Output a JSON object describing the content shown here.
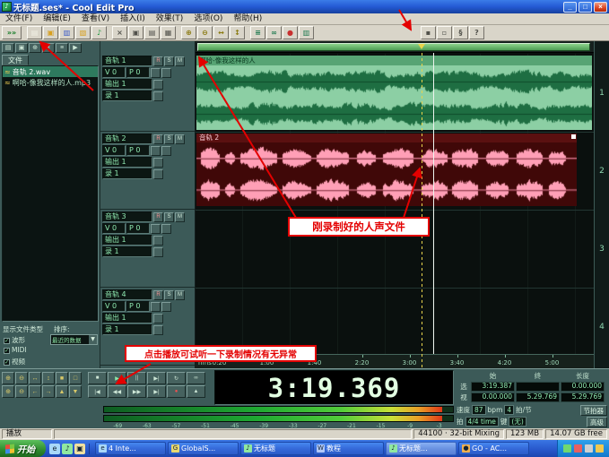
{
  "titlebar": {
    "title": "无标题.ses* - Cool Edit Pro",
    "min": "_",
    "max": "□",
    "close": "×"
  },
  "menu": {
    "items": [
      "文件(F)",
      "编辑(E)",
      "查看(V)",
      "插入(I)",
      "效果(T)",
      "选项(O)",
      "帮助(H)"
    ]
  },
  "toolbar": {
    "buttons": [
      {
        "name": "toggle-view",
        "g": "»»",
        "c": "#0f7a22"
      },
      {
        "name": "new-session",
        "g": "▤",
        "c": "#f0efe4"
      },
      {
        "name": "open-file",
        "g": "▣",
        "c": "#d8a020"
      },
      {
        "name": "save-session",
        "g": "▥",
        "c": "#3a5ac8"
      },
      {
        "name": "import-file",
        "g": "▧",
        "c": "#d8a020"
      },
      {
        "name": "mixdown",
        "g": "♪",
        "c": "#1f9a40"
      },
      {
        "name": "cut",
        "g": "×",
        "c": "#50504a"
      },
      {
        "name": "copy",
        "g": "▣",
        "c": "#50504a"
      },
      {
        "name": "paste",
        "g": "▤",
        "c": "#50504a"
      },
      {
        "name": "mix-paste",
        "g": "▦",
        "c": "#50504a"
      },
      {
        "name": "zoom-in",
        "g": "⊕",
        "c": "#8a7a10"
      },
      {
        "name": "zoom-out",
        "g": "⊖",
        "c": "#8a7a10"
      },
      {
        "name": "zoom-selection",
        "g": "↔",
        "c": "#8a7a10"
      },
      {
        "name": "zoom-full",
        "g": "↕",
        "c": "#8a7a10"
      },
      {
        "name": "track-eq",
        "g": "≡",
        "c": "#1f7a50"
      },
      {
        "name": "loop-mode",
        "g": "∞",
        "c": "#1f7a50"
      },
      {
        "name": "punch-in",
        "g": "●",
        "c": "#c83030"
      },
      {
        "name": "mixer",
        "g": "▥",
        "c": "#1f7a50"
      },
      {
        "name": "group-clips",
        "g": "▪",
        "c": "#50504a"
      },
      {
        "name": "snapping",
        "g": "▫",
        "c": "#50504a"
      },
      {
        "name": "session-properties",
        "g": "§",
        "c": "#50504a"
      },
      {
        "name": "help",
        "g": "?",
        "c": "#50504a"
      }
    ]
  },
  "file_panel": {
    "top_buttons": [
      {
        "name": "organizer-new",
        "g": "▤"
      },
      {
        "name": "organizer-open",
        "g": "▣"
      },
      {
        "name": "organizer-insert",
        "g": "⊕"
      },
      {
        "name": "organizer-close",
        "g": "×"
      },
      {
        "name": "organizer-options",
        "g": "≡"
      },
      {
        "name": "organizer-play",
        "g": "▶"
      }
    ],
    "tab": "文件",
    "files": [
      {
        "icon": "≈",
        "name": "音轨 2.wav"
      },
      {
        "icon": "≈",
        "name": "啊哈-像我这样的人.mp3"
      }
    ],
    "filter_title": "显示文件类型",
    "sort_label": "排序:",
    "check": "✓",
    "types": [
      "波形",
      "MIDI",
      "视频"
    ],
    "sort_value": "最近的数据"
  },
  "tracks": [
    {
      "num": "1",
      "name": "音轨 1",
      "r": "R",
      "s": "S",
      "m": "M",
      "vol": "V 0",
      "pan": "P 0",
      "out": "输出 1",
      "rec": "录 1"
    },
    {
      "num": "2",
      "name": "音轨 2",
      "r": "R",
      "s": "S",
      "m": "M",
      "vol": "V 0",
      "pan": "P 0",
      "out": "输出 1",
      "rec": "录 1"
    },
    {
      "num": "3",
      "name": "音轨 3",
      "r": "R",
      "s": "S",
      "m": "M",
      "vol": "V 0",
      "pan": "P 0",
      "out": "输出 1",
      "rec": "录 1"
    },
    {
      "num": "4",
      "name": "音轨 4",
      "r": "R",
      "s": "S",
      "m": "M",
      "vol": "V 0",
      "pan": "P 0",
      "out": "输出 1",
      "rec": "录 1"
    }
  ],
  "clips": {
    "clip1_title": "啊哈-像我这样的人",
    "clip2_title": "音轨 2"
  },
  "ruler": {
    "unit": "hms",
    "ticks": [
      "0:20",
      "1:00",
      "1:40",
      "2:20",
      "3:00",
      "3:40",
      "4:20",
      "5:00"
    ]
  },
  "zoom": {
    "buttons": [
      {
        "name": "zoom-in",
        "g": "⊕"
      },
      {
        "name": "zoom-out",
        "g": "⊖"
      },
      {
        "name": "zoom-h",
        "g": "↔"
      },
      {
        "name": "zoom-v",
        "g": "↕"
      },
      {
        "name": "zoom-selection",
        "g": "■"
      },
      {
        "name": "zoom-all",
        "g": "□"
      },
      {
        "name": "zoom-in-vert",
        "g": "⊕"
      },
      {
        "name": "zoom-out-vert",
        "g": "⊖"
      },
      {
        "name": "zoom-left",
        "g": "←"
      },
      {
        "name": "zoom-right",
        "g": "→"
      },
      {
        "name": "zoom-up",
        "g": "▲"
      },
      {
        "name": "zoom-down",
        "g": "▼"
      }
    ]
  },
  "transport": {
    "buttons": [
      {
        "name": "stop",
        "g": "■",
        "c": "#cfe8d8"
      },
      {
        "name": "play",
        "g": "▶",
        "c": "#8fe8a8"
      },
      {
        "name": "pause",
        "g": "||",
        "c": "#cfe8d8"
      },
      {
        "name": "play-to-end",
        "g": "▶|",
        "c": "#cfe8d8"
      },
      {
        "name": "play-looped",
        "g": "↻",
        "c": "#cfe8d8"
      },
      {
        "name": "loop",
        "g": "∞",
        "c": "#cfe8d8"
      },
      {
        "name": "go-to-start",
        "g": "|◀",
        "c": "#cfe8d8"
      },
      {
        "name": "rewind",
        "g": "◀◀",
        "c": "#cfe8d8"
      },
      {
        "name": "fast-forward",
        "g": "▶▶",
        "c": "#cfe8d8"
      },
      {
        "name": "go-to-end",
        "g": "▶|",
        "c": "#cfe8d8"
      },
      {
        "name": "record",
        "g": "●",
        "c": "#f05050"
      },
      {
        "name": "eject",
        "g": "▲",
        "c": "#cfe8d8"
      }
    ]
  },
  "time_display": "3:19.369",
  "session_info": {
    "headers": [
      "始",
      "终",
      "长度"
    ],
    "rows": [
      {
        "label": "选",
        "vals": [
          "3:19.387",
          "",
          "0.00.000"
        ]
      },
      {
        "label": "视",
        "vals": [
          "0.00.000",
          "5.29.769",
          "5.29.769"
        ]
      }
    ]
  },
  "tempo": {
    "speed_label": "速度",
    "speed": "87",
    "bpm": "bpm",
    "beats": "4",
    "beats_label": "拍/节",
    "sig_label": "拍",
    "sig": "4/4 time",
    "key_label": "键",
    "key": "(无)",
    "metronome": "节拍器",
    "advanced": "高级"
  },
  "meters": {
    "scale": [
      "-69",
      "-63",
      "-57",
      "-51",
      "-45",
      "-39",
      "-33",
      "-27",
      "-21",
      "-15",
      "-9",
      "-3"
    ]
  },
  "status": {
    "mode": "播放",
    "cells": [
      "44100 · 32-bit Mixing",
      "123 MB",
      "14.07 GB free"
    ]
  },
  "taskbar": {
    "start": "开始",
    "quick": [
      {
        "name": "quicklaunch-browser",
        "g": "e",
        "c": "#a8d8f8"
      },
      {
        "name": "quicklaunch-player",
        "g": "♪",
        "c": "#90e8a0"
      },
      {
        "name": "quicklaunch-desktop",
        "g": "▣",
        "c": "#f0e0a0"
      }
    ],
    "tasks": [
      {
        "label": "4 Inte...",
        "g": "e",
        "c": "#a8d8f8",
        "active": false
      },
      {
        "label": "GlobalS...",
        "g": "G",
        "c": "#e8d870",
        "active": false
      },
      {
        "label": "无标题",
        "g": "♪",
        "c": "#90e8a0",
        "active": false
      },
      {
        "label": "教程",
        "g": "W",
        "c": "#b0c8f8",
        "active": false
      },
      {
        "label": "无标题...",
        "g": "♪",
        "c": "#90e8a0",
        "active": true
      },
      {
        "label": "GO - AC...",
        "g": "●",
        "c": "#f0b050",
        "active": false
      }
    ],
    "tray": [
      {
        "name": "tray-icon-1",
        "c": "#70d870"
      },
      {
        "name": "tray-icon-2",
        "c": "#e86060"
      },
      {
        "name": "tray-icon-3",
        "c": "#d0d0d0"
      },
      {
        "name": "tray-icon-4",
        "c": "#f0c850"
      }
    ]
  },
  "annotations": {
    "note1": "刚录制好的人声文件",
    "note2": "点击播放可试听一下录制情况有无异常"
  }
}
